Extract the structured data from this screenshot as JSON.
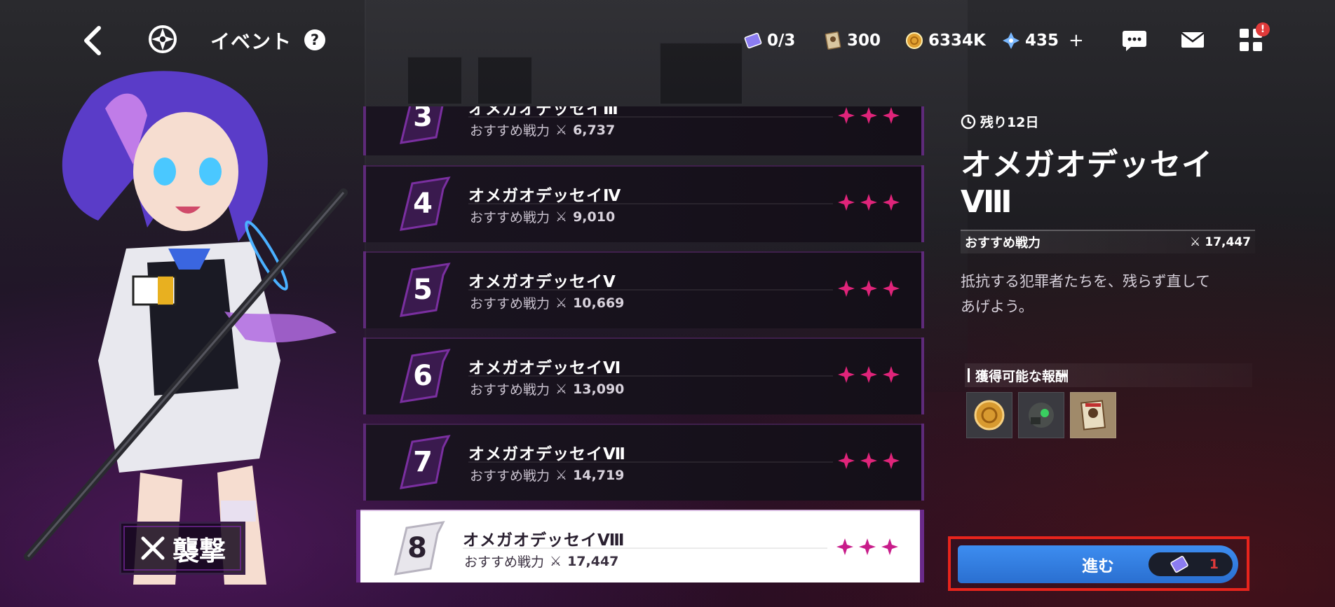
{
  "header": {
    "title": "イベント",
    "help": "?",
    "resources": [
      {
        "icon": "ticket-icon",
        "value": "0/3"
      },
      {
        "icon": "poster-icon",
        "value": "300"
      },
      {
        "icon": "coin-icon",
        "value": "6334K"
      },
      {
        "icon": "crystal-icon",
        "value": "435",
        "plus": "+"
      }
    ],
    "notification_badge": "!"
  },
  "mode_badge": {
    "label": "襲撃"
  },
  "stages": [
    {
      "number": "3",
      "name": "オメガオデッセイⅢ",
      "power_label": "おすすめ戦力",
      "power": "6,737",
      "stars": 3
    },
    {
      "number": "4",
      "name": "オメガオデッセイⅣ",
      "power_label": "おすすめ戦力",
      "power": "9,010",
      "stars": 3
    },
    {
      "number": "5",
      "name": "オメガオデッセイⅤ",
      "power_label": "おすすめ戦力",
      "power": "10,669",
      "stars": 3
    },
    {
      "number": "6",
      "name": "オメガオデッセイⅥ",
      "power_label": "おすすめ戦力",
      "power": "13,090",
      "stars": 3
    },
    {
      "number": "7",
      "name": "オメガオデッセイⅦ",
      "power_label": "おすすめ戦力",
      "power": "14,719",
      "stars": 3
    },
    {
      "number": "8",
      "name": "オメガオデッセイⅧ",
      "power_label": "おすすめ戦力",
      "power": "17,447",
      "stars": 3
    }
  ],
  "detail": {
    "remaining": "残り12日",
    "title": "オメガオデッセイⅧ",
    "power_label": "おすすめ戦力",
    "power": "17,447",
    "description_line1": "抵抗する犯罪者たちを、残らず直して",
    "description_line2": "あげよう。",
    "rewards_title": "獲得可能な報酬",
    "rewards": [
      "coin-reward-icon",
      "gear-reward-icon",
      "poster-reward-icon"
    ]
  },
  "go_button": {
    "label": "進む",
    "cost": "1"
  },
  "colors": {
    "accent": "#e0247a",
    "button": "#3d8df0",
    "highlight_frame": "#e8241c"
  }
}
